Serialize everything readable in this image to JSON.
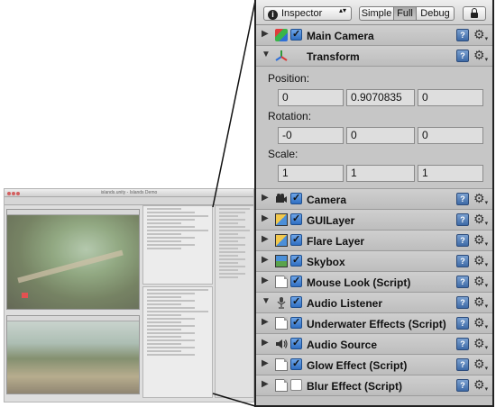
{
  "thumbnail": {
    "window_title": "islands.unity - Islands Demo"
  },
  "toolbar": {
    "inspector_label": "Inspector",
    "updown_glyph": "▴▾",
    "modes": [
      "Simple",
      "Full",
      "Debug"
    ],
    "active_mode": "Full"
  },
  "components": [
    {
      "name": "Main Camera",
      "icon": "camera-cube-icon",
      "expanded": false,
      "enabled": true
    },
    {
      "name": "Transform",
      "icon": "transform-axes-icon",
      "expanded": true,
      "has_checkbox": false
    },
    {
      "name": "Camera",
      "icon": "camera-icon",
      "expanded": false,
      "enabled": true
    },
    {
      "name": "GUILayer",
      "icon": "gui-layer-icon",
      "expanded": false,
      "enabled": true
    },
    {
      "name": "Flare Layer",
      "icon": "flare-layer-icon",
      "expanded": false,
      "enabled": true
    },
    {
      "name": "Skybox",
      "icon": "skybox-icon",
      "expanded": false,
      "enabled": true
    },
    {
      "name": "Mouse Look (Script)",
      "icon": "script-icon",
      "expanded": false,
      "enabled": true
    },
    {
      "name": "Audio Listener",
      "icon": "audio-listener-icon",
      "expanded": true,
      "enabled": true
    },
    {
      "name": "Underwater Effects (Script)",
      "icon": "script-icon",
      "expanded": false,
      "enabled": true
    },
    {
      "name": "Audio Source",
      "icon": "audio-source-icon",
      "expanded": false,
      "enabled": true
    },
    {
      "name": "Glow Effect (Script)",
      "icon": "script-icon",
      "expanded": false,
      "enabled": true
    },
    {
      "name": "Blur Effect (Script)",
      "icon": "script-icon",
      "expanded": false,
      "enabled": false
    }
  ],
  "transform": {
    "position_label": "Position:",
    "position": [
      "0",
      "0.9070835",
      "0"
    ],
    "rotation_label": "Rotation:",
    "rotation": [
      "-0",
      "0",
      "0"
    ],
    "scale_label": "Scale:",
    "scale": [
      "1",
      "1",
      "1"
    ]
  },
  "colors": {
    "panel_bg": "#c2c2c2",
    "checkbox_blue": "#3b78c8",
    "border_dark": "#222222"
  }
}
